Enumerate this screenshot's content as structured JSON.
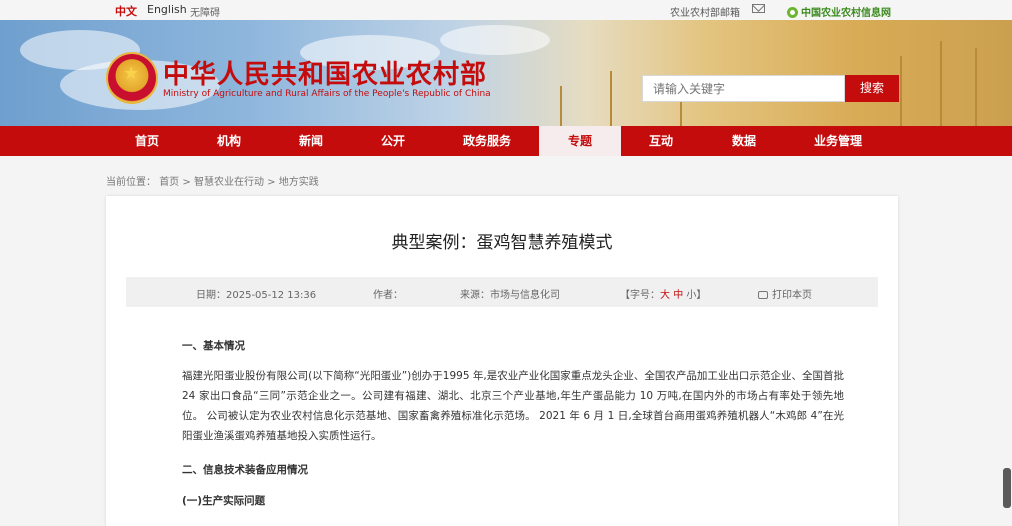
{
  "topbar": {
    "lang_cn": "中文",
    "lang_en": "English",
    "accessibility": "无障碍",
    "mailbox": "农业农村部邮箱",
    "info_net": "中国农业农村信息网"
  },
  "header": {
    "title": "中华人民共和国农业农村部",
    "subtitle": "Ministry of Agriculture and Rural Affairs of the People's Republic of China",
    "search_placeholder": "请输入关键字",
    "search_button": "搜索"
  },
  "nav": {
    "items": [
      "首页",
      "机构",
      "新闻",
      "公开",
      "政务服务",
      "专题",
      "互动",
      "数据",
      "业务管理"
    ],
    "active": "专题"
  },
  "breadcrumb": {
    "prefix": "当前位置：",
    "home": "首页",
    "sep": ">",
    "level1": "智慧农业在行动",
    "level2": "地方实践"
  },
  "article": {
    "title": "典型案例：蛋鸡智慧养殖模式",
    "date_label": "日期：2025-05-12 13:36",
    "author_label": "作者：",
    "source_label": "来源：市场与信息化司",
    "fontsize_prefix": "【字号：",
    "fontsize_big": "大",
    "fontsize_mid": "中",
    "fontsize_small": "小",
    "fontsize_suffix": "】",
    "print_label": "打印本页",
    "section1_title": "一、基本情况",
    "section1_para": "福建光阳蛋业股份有限公司(以下简称“光阳蛋业”)创办于1995 年,是农业产业化国家重点龙头企业、全国农产品加工业出口示范企业、全国首批 24 家出口食品“三同”示范企业之一。公司建有福建、湖北、北京三个产业基地,年生产蛋品能力 10 万吨,在国内外的市场占有率处于领先地位。 公司被认定为农业农村信息化示范基地、国家畜禽养殖标准化示范场。 2021 年 6 月 1 日,全球首台商用蛋鸡养殖机器人“木鸡郎 4”在光阳蛋业渔溪蛋鸡养殖基地投入实质性运行。",
    "section2_title": "二、信息技术装备应用情况",
    "section2_sub": "(一)生产实际问题"
  },
  "colors": {
    "brand_red": "#c40c0c",
    "nav_active_bg": "#f7eced",
    "info_net_green": "#3a8a1e"
  }
}
